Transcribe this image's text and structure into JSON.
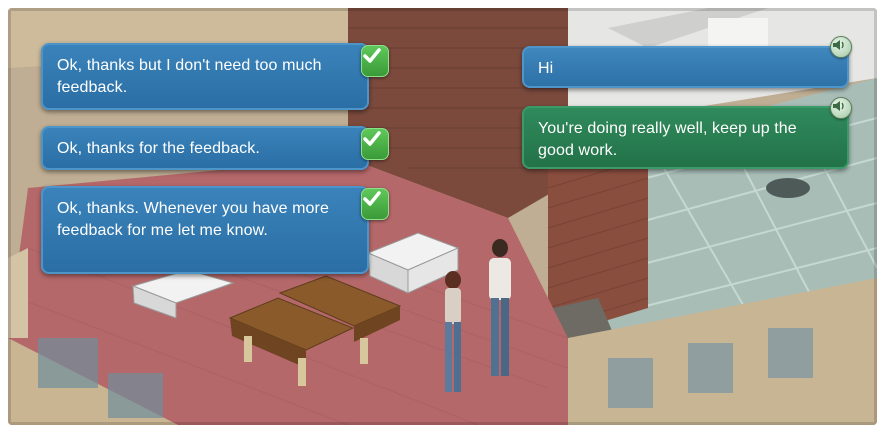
{
  "dialogue_options": [
    {
      "text": "Ok, thanks but I don't need too much feedback.",
      "icon": "checkmark-icon"
    },
    {
      "text": "Ok, thanks for the feedback.",
      "icon": "checkmark-icon"
    },
    {
      "text": "Ok, thanks. Whenever you have more feedback for me let me know.",
      "icon": "checkmark-icon"
    }
  ],
  "npc_lines": [
    {
      "text": "Hi",
      "icon": "speaker-icon"
    },
    {
      "text": "You're doing really well, keep up the good work.",
      "icon": "speaker-icon"
    }
  ],
  "colors": {
    "option_bubble": "#2f75ad",
    "npc_bubble_blue": "#3479b0",
    "npc_bubble_green": "#2a7d52",
    "checkmark": "#4cb04a",
    "carpet": "#b56a6c",
    "brick": "#8b4a3a",
    "glass_floor": "#9fb7b0"
  }
}
